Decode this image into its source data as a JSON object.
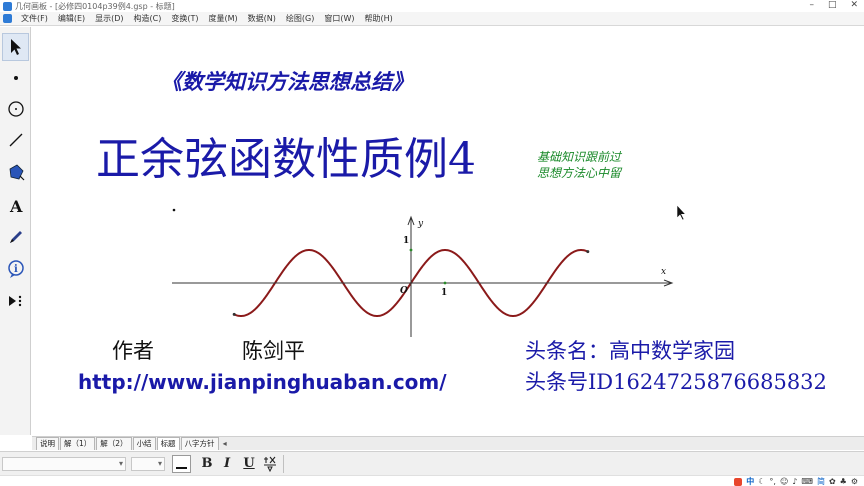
{
  "window": {
    "title": "几何画板 - [必修四0104p39例4.gsp - 标题]"
  },
  "menus": [
    "文件(F)",
    "编辑(E)",
    "显示(D)",
    "构造(C)",
    "变换(T)",
    "度量(M)",
    "数据(N)",
    "绘图(G)",
    "窗口(W)",
    "帮助(H)"
  ],
  "tools": [
    "arrow-select-tool",
    "point-tool",
    "compass-tool",
    "straightedge-tool",
    "polygon-tool",
    "text-tool",
    "marker-tool",
    "information-tool",
    "custom-tools"
  ],
  "canvas": {
    "series_title": "《数学知识方法思想总结》",
    "main_title": "正余弦函数性质例4",
    "side_note_line1": "基础知识跟前过",
    "side_note_line2": "思想方法心中留",
    "graph": {
      "y_axis_label": "y",
      "x_axis_label": "x",
      "origin_label": "O",
      "y_tick_label": "1",
      "x_tick_label": "1"
    },
    "author_label": "作者",
    "author_name": "陈剑平",
    "website": "http://www.jianpinghuaban.com/",
    "toutiao_name": "头条名：高中数学家园",
    "toutiao_id": "头条号ID1624725876685832"
  },
  "page_tabs": [
    "说明",
    "解（1）",
    "解（2）",
    "小结",
    "标题",
    "八字方针"
  ],
  "active_tab": "标题",
  "format": {
    "bold": "B",
    "italic": "I",
    "underline": "U"
  },
  "tray": {
    "ime": "中",
    "simplified": "简"
  },
  "chart_data": {
    "type": "line",
    "title": "",
    "xlabel": "x",
    "ylabel": "y",
    "y": [
      -1,
      1
    ],
    "x_range": [
      -5.2,
      5.2
    ],
    "ylim": [
      -1,
      1
    ],
    "series": [
      {
        "function": "y = sin(πx/2)",
        "x_start": -5.2,
        "x_end": 5.2,
        "color": "#8b1a1a"
      }
    ],
    "grid": false
  }
}
